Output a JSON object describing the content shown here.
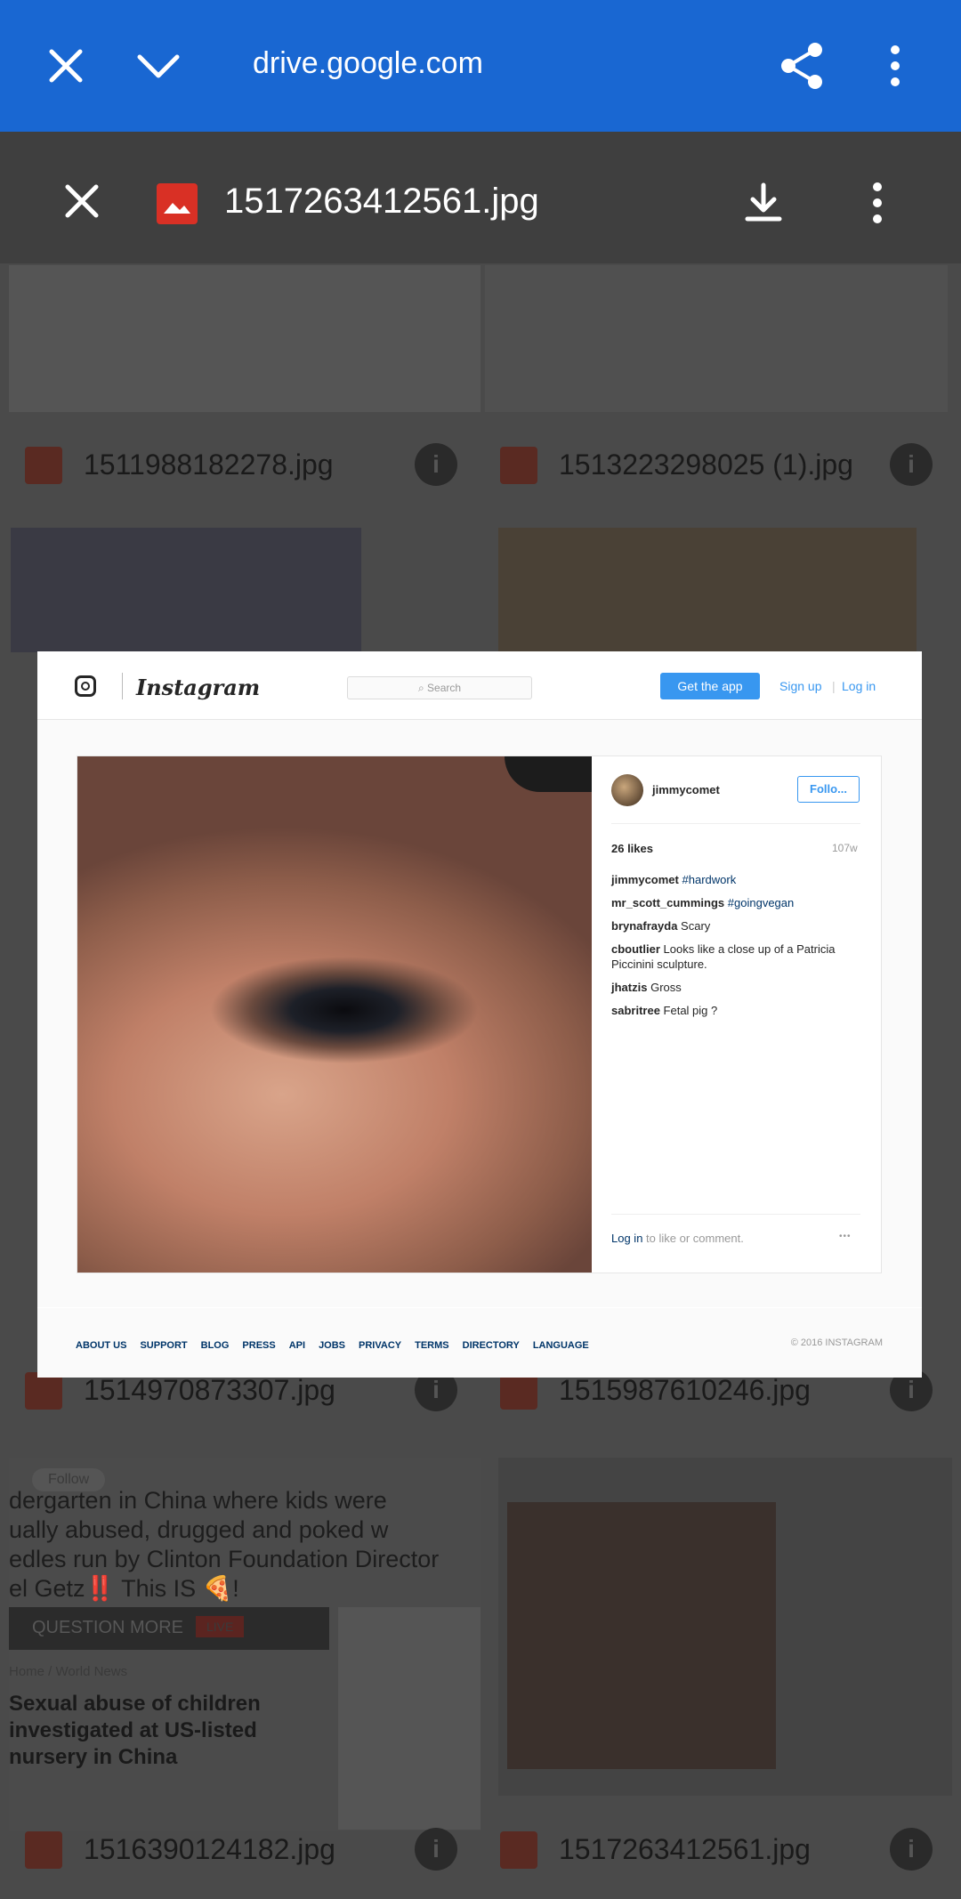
{
  "browser": {
    "url": "drive.google.com",
    "close_icon": "close-icon",
    "collapse_icon": "chevron-down-icon",
    "share_icon": "share-icon",
    "more_icon": "more-vert-icon"
  },
  "viewer": {
    "file_name": "1517263412561.jpg",
    "close_icon": "close-icon",
    "download_icon": "download-icon",
    "more_icon": "more-vert-icon"
  },
  "background_files": [
    {
      "name": "1511988182278.jpg"
    },
    {
      "name": "1513223298025 (1).jpg"
    },
    {
      "name": "1514970873307.jpg"
    },
    {
      "name": "1515987610246.jpg"
    },
    {
      "name": "1516390124182.jpg"
    },
    {
      "name": "1517263412561.jpg"
    }
  ],
  "background_snippet": {
    "headline_lines": [
      "dergarten in China where kids were",
      "ually abused, drugged and poked w",
      "edles run by Clinton Foundation Director",
      "el Getz‼️ This IS 🍕!"
    ],
    "site_bar": "QUESTION MORE",
    "site_bar_badge": "LIVE",
    "breadcrumb": "Home / World News",
    "article_title": "Sexual abuse of children investigated at US-listed nursery in China",
    "follow_label": "Follow"
  },
  "instagram": {
    "brand": "Instagram",
    "search_placeholder": "Search",
    "get_app": "Get the app",
    "sign_up": "Sign up",
    "log_in": "Log in",
    "username": "jimmycomet",
    "follow": "Follo...",
    "likes": "26 likes",
    "age": "107w",
    "comments": [
      {
        "user": "jimmycomet",
        "text": "",
        "tag": "#hardwork"
      },
      {
        "user": "mr_scott_cummings",
        "text": "",
        "tag": "#goingvegan"
      },
      {
        "user": "brynafrayda",
        "text": "Scary",
        "tag": ""
      },
      {
        "user": "cboutlier",
        "text": "Looks like a close up of a Patricia Piccinini sculpture.",
        "tag": ""
      },
      {
        "user": "jhatzis",
        "text": "Gross",
        "tag": ""
      },
      {
        "user": "sabritree",
        "text": "Fetal pig ?",
        "tag": ""
      }
    ],
    "login_prompt_link": "Log in",
    "login_prompt_text": " to like or comment.",
    "more_dots": "•••",
    "footer_links": [
      "About us",
      "Support",
      "Blog",
      "Press",
      "API",
      "Jobs",
      "Privacy",
      "Terms",
      "Directory",
      "Language"
    ],
    "copyright": "© 2016 INSTAGRAM"
  },
  "colors": {
    "browser_bar": "#1967d2",
    "instagram_blue": "#3897f0",
    "instagram_link": "#003569",
    "file_badge": "#d93025"
  }
}
